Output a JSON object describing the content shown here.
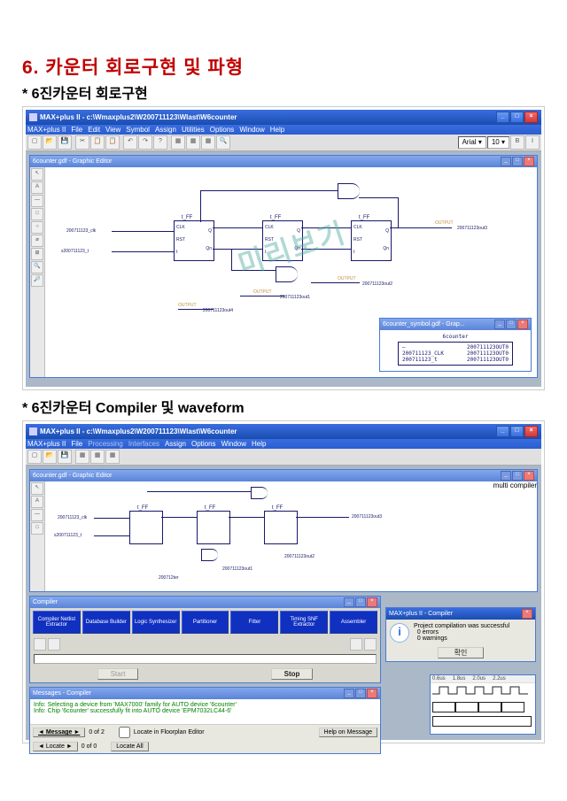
{
  "heading": "6. 카운터 회로구현 및 파형",
  "sub1": "* 6진카운터 회로구현",
  "sub2": "* 6진카운터 Compiler 및 waveform",
  "watermark": "미리보기",
  "app": {
    "title": "MAX+plus II - c:\\Wmaxplus2\\W200711123\\Wlast\\W6counter",
    "menus": [
      "MAX+plus II",
      "File",
      "Edit",
      "View",
      "Symbol",
      "Assign",
      "Utilities",
      "Options",
      "Window",
      "Help"
    ],
    "toolbar_glyphs": [
      "▢",
      "📂",
      "💾",
      "✂",
      "📋",
      "📋",
      "↶",
      "↷",
      "?",
      "▦",
      "▦",
      "▦",
      "🔍"
    ],
    "font": "Arial",
    "font_size": "10",
    "editor_title": "6counter.gdf - Graphic Editor",
    "palette_glyphs": [
      "↖",
      "A",
      "—",
      "□",
      "○",
      "⌀",
      "⊞",
      "🔍",
      "🔎"
    ]
  },
  "schematic": {
    "ff_label": "t_FF",
    "ff_pins_left": [
      "CLK",
      "RST",
      "t"
    ],
    "ff_pins_right": [
      "Q",
      "Qn"
    ],
    "sig_clk": "200711123_clk",
    "sig_t": "s200711123_t",
    "out1": "200711123out1",
    "out2": "200711123out2",
    "out3": "200711123out3",
    "out4": "200711123out4",
    "output_tag": "OUTPUT"
  },
  "symbol": {
    "title": "6counter_symbol.gdf - Grap...",
    "name": "6counter",
    "ports": [
      "200711123OUT0",
      "200711123_CLK",
      "200711123OUT0",
      "200711123_t",
      "200711123OUT0"
    ]
  },
  "app2_title": "MAX+plus II - c:\\Wmaxplus2\\W200711123\\Wlast\\W6counter",
  "compiler": {
    "title": "Compiler",
    "stages": [
      "Compiler Netlist Extractor",
      "Database Builder",
      "Logic Synthesizer",
      "Partitioner",
      "Fitter",
      "Timing SNF Extractor",
      "Assembler"
    ],
    "start": "Start",
    "stop": "Stop"
  },
  "dialog": {
    "title": "MAX+plus II - Compiler",
    "text1": "Project compilation was successful",
    "text2": "0 errors",
    "text3": "0 warnings",
    "ok": "확인"
  },
  "messages": {
    "title": "Messages - Compiler",
    "line1": "Info: Selecting a device from 'MAX7000' family for AUTO device '6counter'",
    "line2": "Info: Chip '6counter' successfully fit into AUTO device 'EPM7032LC44-6'",
    "btn_message": "◄ Message ►",
    "count": "0 of 2",
    "btn_locate": "◄ Locate ►",
    "count2": "0 of 0",
    "check": "Locate in Floorplan Editor",
    "locate_all": "Locate All",
    "help": "Help on Message"
  },
  "waveform": {
    "times": [
      "0.6us",
      "1.8us",
      "2.0us",
      "2.2us"
    ]
  }
}
